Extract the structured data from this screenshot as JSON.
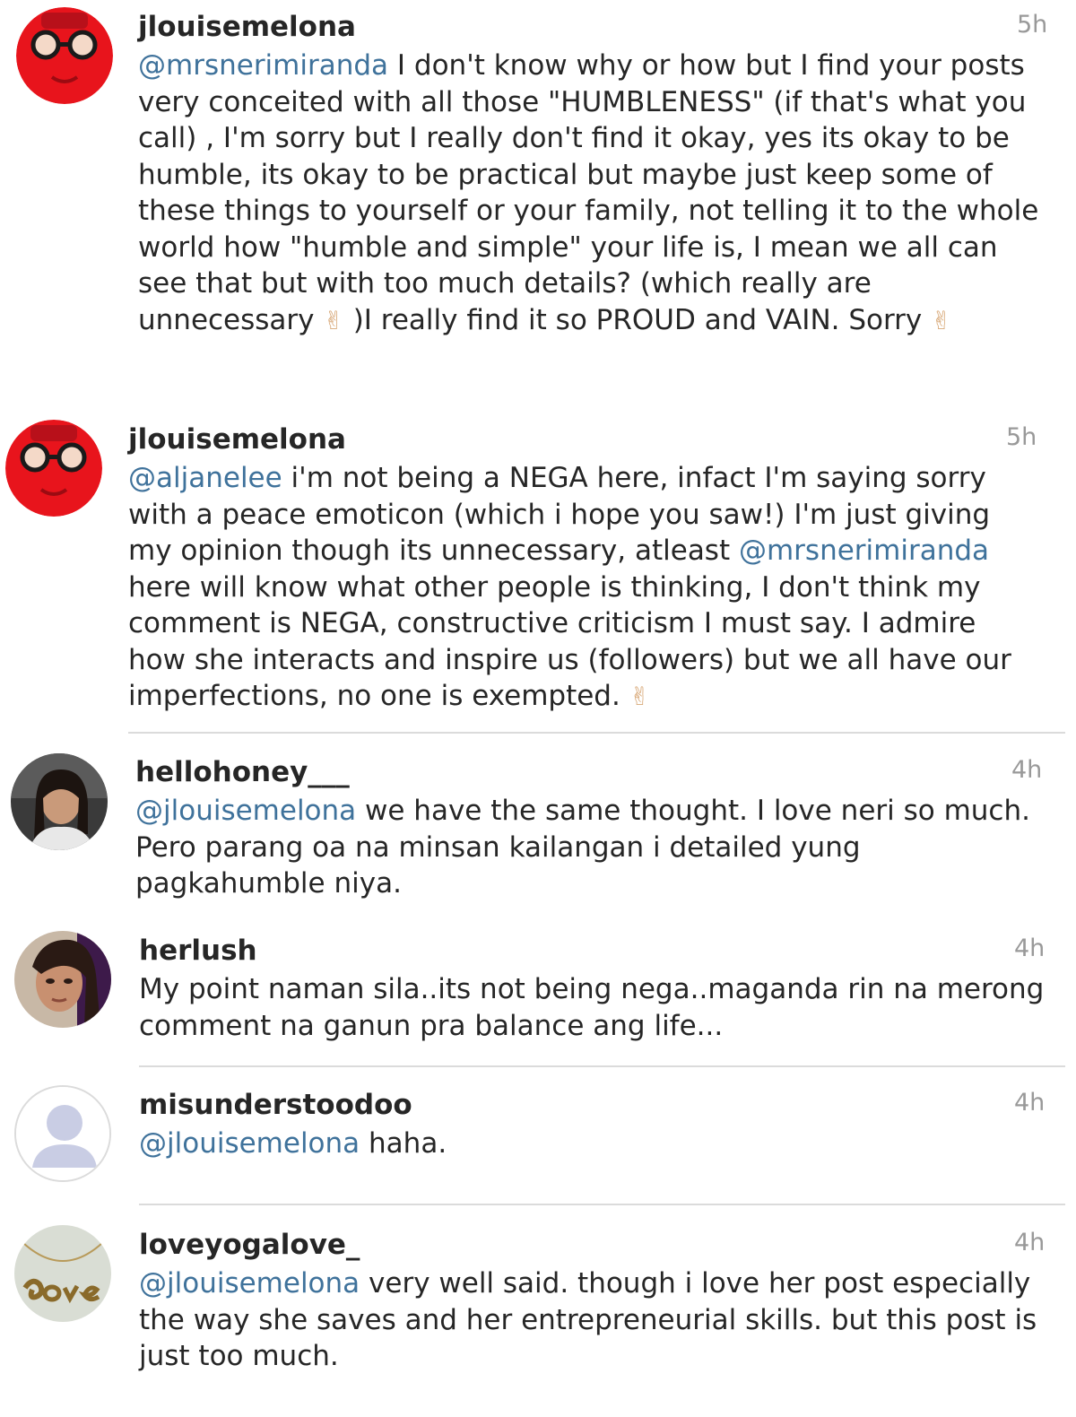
{
  "colors": {
    "mention": "#3f729b",
    "username": "#262626",
    "timestamp": "#999999",
    "divider": "#dbdbdb"
  },
  "comments": [
    {
      "username": "jlouisemelona",
      "time": "5h",
      "avatar": "red-cartoon-face-with-glasses",
      "parts": [
        {
          "mention": "@mrsnerimiranda"
        },
        {
          "text": "  I don't know why or how but I find your posts very conceited with all those \"HUMBLENESS\" (if that's what you call) , I'm sorry but I really don't find it okay, yes its okay to be humble, its okay to be practical but maybe just keep some of these things to yourself or your family, not telling it to the whole world how \"humble and simple\" your life is, I mean we all can see that but with too much details? (which really are unnecessary "
        },
        {
          "emoji": "✌"
        },
        {
          "text": " )I really find it so PROUD and VAIN. Sorry "
        },
        {
          "emoji": "✌"
        }
      ]
    },
    {
      "username": "jlouisemelona",
      "time": "5h",
      "avatar": "red-cartoon-face-with-glasses",
      "parts": [
        {
          "mention": "@aljanelee"
        },
        {
          "text": " i'm not being a NEGA here, infact I'm saying sorry with a peace emoticon (which i hope you saw!) I'm just giving my opinion though its unnecessary, atleast "
        },
        {
          "mention": "@mrsnerimiranda"
        },
        {
          "text": " here will know what other people is thinking, I don't think my comment is NEGA, constructive criticism I must say. I admire how she interacts and inspire us (followers) but we all have our imperfections, no one is exempted. "
        },
        {
          "emoji": "✌"
        }
      ]
    },
    {
      "username": "hellohoney___",
      "time": "4h",
      "avatar": "woman-selfie-photo",
      "parts": [
        {
          "mention": "@jlouisemelona"
        },
        {
          "text": " we have the same thought. I love neri so much. Pero parang oa na minsan kailangan i detailed yung pagkahumble niya."
        }
      ]
    },
    {
      "username": "herlush",
      "time": "4h",
      "avatar": "woman-portrait-photo",
      "parts": [
        {
          "text": "My point naman sila..its not being nega..maganda rin na merong comment na ganun pra balance ang life..."
        }
      ]
    },
    {
      "username": "misunderstoodoo",
      "time": "4h",
      "avatar": "default-user-silhouette",
      "parts": [
        {
          "mention": "@jlouisemelona"
        },
        {
          "text": " haha."
        }
      ]
    },
    {
      "username": "loveyogalove_",
      "time": "4h",
      "avatar": "gold-love-necklace-photo",
      "parts": [
        {
          "mention": "@jlouisemelona"
        },
        {
          "text": " very well said. though i love her post especially the way she saves and her entrepreneurial skills. but this post is just too much."
        }
      ]
    }
  ]
}
